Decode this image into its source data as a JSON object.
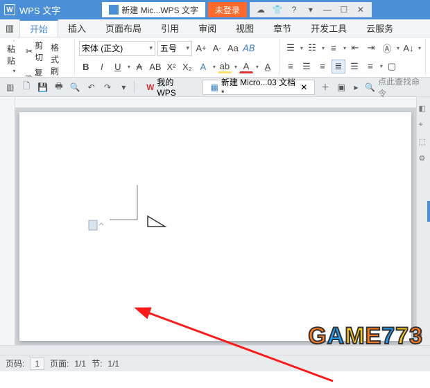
{
  "titlebar": {
    "app_name": "WPS 文字",
    "doc_tab": "新建 Mic...WPS 文字",
    "login": "未登录"
  },
  "menu": {
    "tabs": [
      "开始",
      "插入",
      "页面布局",
      "引用",
      "审阅",
      "视图",
      "章节",
      "开发工具",
      "云服务"
    ]
  },
  "ribbon": {
    "paste": "粘贴",
    "cut": "剪切",
    "copy": "复制",
    "format_painter": "格式刷",
    "font_family": "宋体 (正文)",
    "font_size": "五号",
    "bold": "B",
    "italic": "I",
    "underline": "U",
    "strike": "A",
    "super": "X²",
    "sub": "X₂",
    "bullet1": "≔",
    "bullet2": "≔",
    "bullet3": "≔",
    "align1": "≡",
    "align2": "≡",
    "align3": "≡",
    "align4": "≡"
  },
  "quickbar": {
    "my_wps": "我的WPS",
    "doc_name": "新建 Micro...03 文档 *",
    "search_placeholder": "点此查找命令"
  },
  "statusbar": {
    "page_label": "页码:",
    "page_val": "1",
    "pages_label": "页面:",
    "pages_val": "1/1",
    "section_label": "节:",
    "section_val": "1/1"
  },
  "watermark": "GAME773"
}
